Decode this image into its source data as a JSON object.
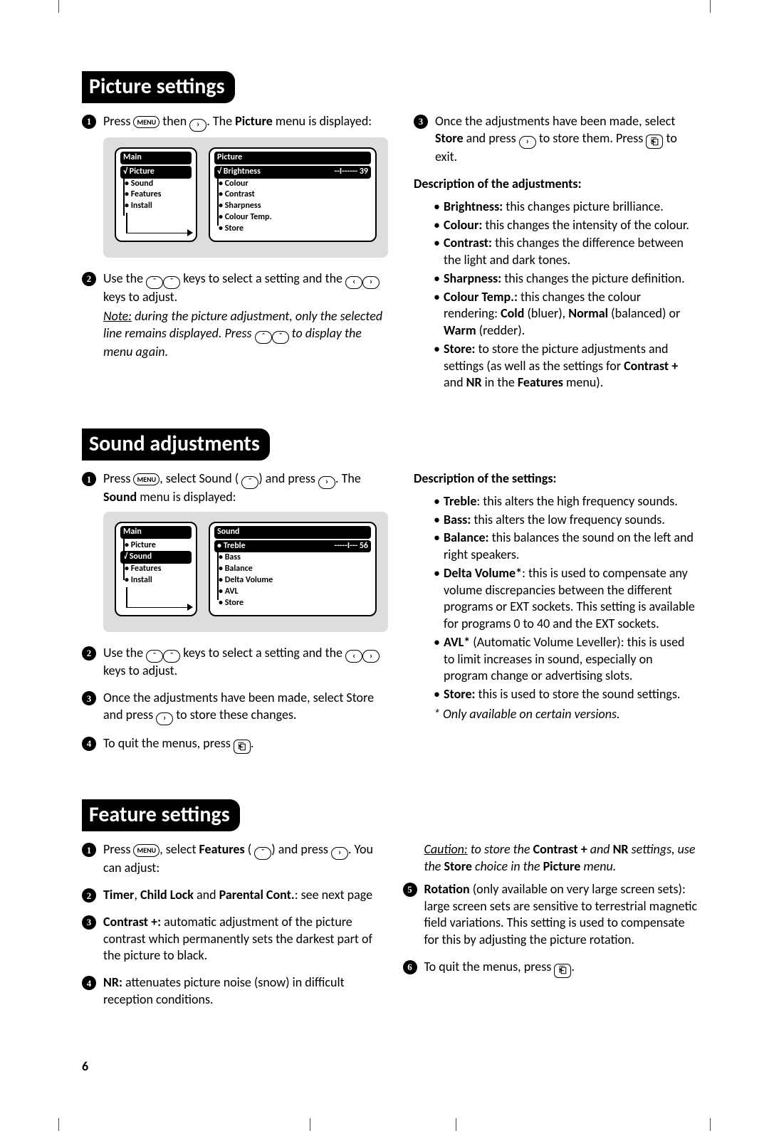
{
  "labels": {
    "menu": "MENU",
    "right": "›",
    "left": "‹",
    "up": "ˆ",
    "down": "ˇ",
    "exit": "⎗"
  },
  "page_number": "6",
  "picture": {
    "heading": "Picture settings",
    "step1a": "Press ",
    "step1b": " then ",
    "step1c": ". The ",
    "step1d": "Picture",
    "step1e": " menu is displayed:",
    "osd": {
      "main_title": "Main",
      "main_selected": "Picture",
      "main_items": [
        "Sound",
        "Features",
        "Install"
      ],
      "sub_title": "Picture",
      "sub_selected_label": "Brightness",
      "sub_selected_bar": "--I------",
      "sub_selected_val": "39",
      "sub_items": [
        "Colour",
        "Contrast",
        "Sharpness",
        "Colour Temp.",
        "Store"
      ]
    },
    "step2a": "Use the ",
    "step2b": " keys to select a setting and the ",
    "step2c": " keys to adjust.",
    "note_a": "Note:",
    "note_b": " during the picture adjustment, only the selected line remains displayed. Press ",
    "note_c": " to display the menu again.",
    "step3a": "Once the adjustments have been made, select ",
    "step3b": "Store",
    "step3c": " and press ",
    "step3d": " to store them. Press ",
    "step3e": " to exit.",
    "desc_heading": "Description of the adjustments:",
    "desc": {
      "brightness_b": "Brightness:",
      "brightness_t": " this changes picture brilliance.",
      "colour_b": "Colour:",
      "colour_t": " this changes the intensity of the colour.",
      "contrast_b": "Contrast:",
      "contrast_t": " this changes the difference between the light and dark tones.",
      "sharpness_b": "Sharpness:",
      "sharpness_t": " this changes the picture definition.",
      "ctemp_b": "Colour Temp.:",
      "ctemp_t1": " this changes the colour rendering: ",
      "ctemp_cold": "Cold",
      "ctemp_t2": " (bluer), ",
      "ctemp_normal": "Normal",
      "ctemp_t3": " (balanced) or ",
      "ctemp_warm": "Warm",
      "ctemp_t4": " (redder).",
      "store_b": "Store:",
      "store_t1": " to store the picture adjustments and settings (as well as the settings for ",
      "store_cplus": "Contrast +",
      "store_t2": " and ",
      "store_nr": "NR",
      "store_t3": " in the ",
      "store_feat": "Features",
      "store_t4": " menu)."
    }
  },
  "sound": {
    "heading": "Sound adjustments",
    "step1a": "Press ",
    "step1b": ", select Sound (",
    "step1c": ") and press ",
    "step1d": ". The ",
    "step1e": "Sound",
    "step1f": " menu is displayed:",
    "osd": {
      "main_title": "Main",
      "main_items_before": [
        "Picture"
      ],
      "main_selected": "Sound",
      "main_items_after": [
        "Features",
        "Install"
      ],
      "sub_title": "Sound",
      "sub_selected_label": "Treble",
      "sub_selected_bar": "-----I---",
      "sub_selected_val": "56",
      "sub_items": [
        "Bass",
        "Balance",
        "Delta Volume",
        "AVL",
        "Store"
      ]
    },
    "step2a": "Use the ",
    "step2b": " keys to select a setting and the ",
    "step2c": " keys to adjust.",
    "step3a": "Once the adjustments have been made, select Store and press ",
    "step3b": " to store these changes.",
    "step4a": "To quit the menus, press ",
    "step4b": ".",
    "desc_heading": "Description of the settings:",
    "desc": {
      "treble_b": "Treble",
      "treble_t": ": this alters the high frequency sounds.",
      "bass_b": "Bass:",
      "bass_t": " this alters the low frequency sounds.",
      "balance_b": "Balance:",
      "balance_t": " this balances the sound on the left and right speakers.",
      "delta_b": "Delta Volume*",
      "delta_t": ": this is used to compensate any volume discrepancies between the different programs or EXT sockets. This setting is available for programs 0 to 40 and the EXT sockets.",
      "avl_b": "AVL*",
      "avl_t": " (Automatic Volume Leveller): this is used to limit increases in sound, especially on program change or advertising slots.",
      "store_b": "Store:",
      "store_t": " this is used to store the sound settings.",
      "footnote": "* Only available on certain versions."
    }
  },
  "features": {
    "heading": "Feature settings",
    "step1a": "Press ",
    "step1b": ", select ",
    "step1c": "Features",
    "step1d": " (",
    "step1e": ") and press ",
    "step1f": ". You can adjust:",
    "step2a": "Timer",
    "step2b": ", ",
    "step2c": "Child Lock",
    "step2d": " and ",
    "step2e": "Parental Cont.",
    "step2f": ": see next page",
    "step3a": "Contrast +:",
    "step3b": " automatic adjustment of the picture contrast which permanently sets the darkest part of the picture to black.",
    "step4a": "NR:",
    "step4b": " attenuates picture noise (snow) in difficult reception conditions.",
    "caution_a": "Caution:",
    "caution_b": " to store the ",
    "caution_c": "Contrast +",
    "caution_d": " and ",
    "caution_e": "NR",
    "caution_f": " settings, use the ",
    "caution_g": "Store",
    "caution_h": " choice in the ",
    "caution_i": "Picture",
    "caution_j": " menu.",
    "step5a": "Rotation",
    "step5b": " (only available on very large screen sets): large screen sets are sensitive to terrestrial magnetic field variations. This setting is used to compensate for this by adjusting the picture rotation.",
    "step6a": "To quit the menus, press ",
    "step6b": "."
  }
}
